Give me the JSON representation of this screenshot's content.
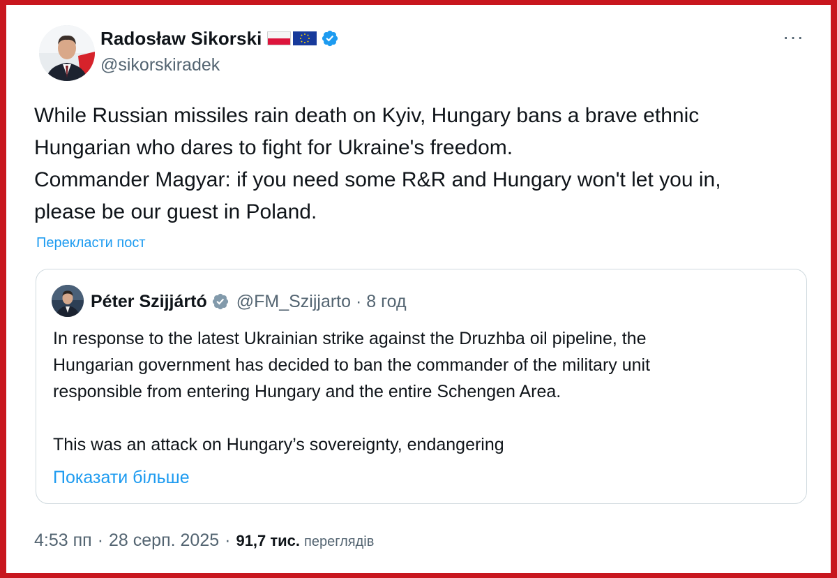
{
  "post": {
    "author_name": "Radosław Sikorski",
    "author_handle": "@sikorskiradek",
    "more_label": "···",
    "text_lines": [
      "While Russian missiles rain death on Kyiv, Hungary bans a brave ethnic",
      "Hungarian who dares to fight for Ukraine's freedom.",
      "Commander Magyar: if you need some R&R and Hungary won't let you in,",
      "please be our guest in Poland."
    ],
    "translate_label": "Перекласти пост"
  },
  "quote": {
    "author_name": "Péter Szijjártó",
    "author_handle": "@FM_Szijjarto",
    "time": "8 год",
    "separator": "·",
    "paragraph1": [
      "In response to the latest Ukrainian strike against the Druzhba oil pipeline, the",
      "Hungarian government has decided to ban the commander of the military unit",
      "responsible from entering Hungary and the entire Schengen Area."
    ],
    "paragraph2": "This was an attack on Hungary’s sovereignty, endangering",
    "show_more_label": "Показати більше"
  },
  "footer": {
    "time": "4:53 пп",
    "separator": "·",
    "date": "28 серп. 2025",
    "views_count": "91,7 тис.",
    "views_label": "переглядів"
  },
  "colors": {
    "frame": "#c8161e",
    "link": "#1d9bf0",
    "verified_blue": "#1d9bf0",
    "verified_gray": "#829aab",
    "text": "#0f1419",
    "muted": "#536471"
  },
  "icons": {
    "flag_1": "poland-flag-icon",
    "flag_2": "eu-flag-icon",
    "badge": "verified-badge-icon",
    "quote_badge": "verified-gray-badge-icon"
  }
}
